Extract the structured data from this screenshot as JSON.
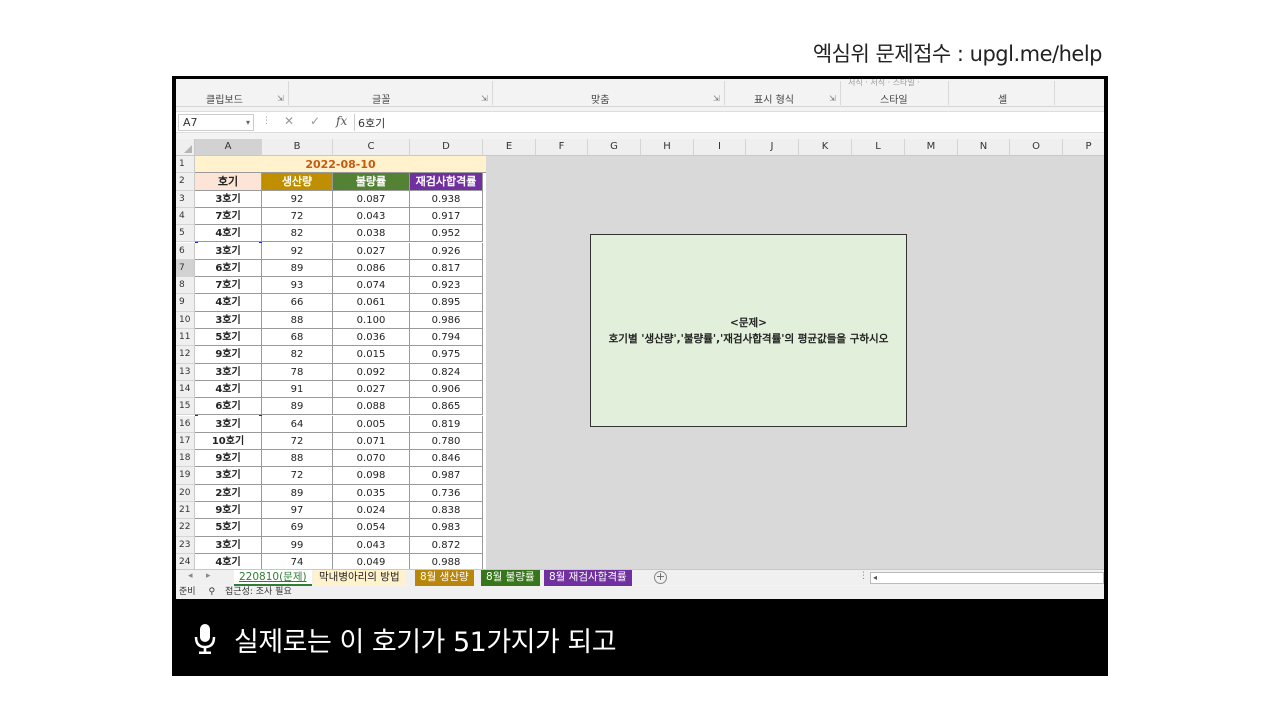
{
  "header_text": "엑심위 문제접수 : upgl.me/help",
  "ribbon": {
    "groups": [
      "클립보드",
      "글꼴",
      "맞춤",
      "표시 형식",
      "스타일",
      "셀"
    ],
    "faint_text": "서식 · 서식 · 스타일 ·"
  },
  "formula_bar": {
    "name_box": "A7",
    "cancel_icon": "✕",
    "enter_icon": "✓",
    "fx_label": "fx",
    "formula_value": "6호기"
  },
  "grid": {
    "columns": [
      "A",
      "B",
      "C",
      "D",
      "E",
      "F",
      "G",
      "H",
      "I",
      "J",
      "K",
      "L",
      "M",
      "N",
      "O",
      "P"
    ],
    "row_numbers": [
      "1",
      "2",
      "3",
      "4",
      "5",
      "6",
      "7",
      "8",
      "9",
      "10",
      "11",
      "12",
      "13",
      "14",
      "15",
      "16",
      "17",
      "18",
      "19",
      "20",
      "21",
      "22",
      "23",
      "24"
    ],
    "date_header": "2022-08-10",
    "headers": [
      "호기",
      "생산량",
      "불량률",
      "재검사합격률"
    ],
    "rows": [
      [
        "3호기",
        "92",
        "0.087",
        "0.938"
      ],
      [
        "7호기",
        "72",
        "0.043",
        "0.917"
      ],
      [
        "4호기",
        "82",
        "0.038",
        "0.952"
      ],
      [
        "3호기",
        "92",
        "0.027",
        "0.926"
      ],
      [
        "6호기",
        "89",
        "0.086",
        "0.817"
      ],
      [
        "7호기",
        "93",
        "0.074",
        "0.923"
      ],
      [
        "4호기",
        "66",
        "0.061",
        "0.895"
      ],
      [
        "3호기",
        "88",
        "0.100",
        "0.986"
      ],
      [
        "5호기",
        "68",
        "0.036",
        "0.794"
      ],
      [
        "9호기",
        "82",
        "0.015",
        "0.975"
      ],
      [
        "3호기",
        "78",
        "0.092",
        "0.824"
      ],
      [
        "4호기",
        "91",
        "0.027",
        "0.906"
      ],
      [
        "6호기",
        "89",
        "0.088",
        "0.865"
      ],
      [
        "3호기",
        "64",
        "0.005",
        "0.819"
      ],
      [
        "10호기",
        "72",
        "0.071",
        "0.780"
      ],
      [
        "9호기",
        "88",
        "0.070",
        "0.846"
      ],
      [
        "3호기",
        "72",
        "0.098",
        "0.987"
      ],
      [
        "2호기",
        "89",
        "0.035",
        "0.736"
      ],
      [
        "9호기",
        "97",
        "0.024",
        "0.838"
      ],
      [
        "5호기",
        "69",
        "0.054",
        "0.983"
      ],
      [
        "3호기",
        "99",
        "0.043",
        "0.872"
      ],
      [
        "4호기",
        "74",
        "0.049",
        "0.988"
      ]
    ]
  },
  "problem": {
    "title": "<문제>",
    "body": "호기별 '생산량','불량률','재검사합격률'의 평균값들을 구하시오"
  },
  "sheet_tabs": [
    {
      "label": "220810(문제)",
      "bg": "#ffffff",
      "color": "#2e7d32"
    },
    {
      "label": "막내병아리의 방법",
      "bg": "#fff2cc",
      "color": "#222222"
    },
    {
      "label": "8월 생산량",
      "bg": "#b8860b",
      "color": "#ffffff"
    },
    {
      "label": "8월 불량률",
      "bg": "#38761d",
      "color": "#ffffff"
    },
    {
      "label": "8월 재검사합격률",
      "bg": "#7030a0",
      "color": "#ffffff"
    }
  ],
  "status_bar": {
    "ready": "준비",
    "accessibility": "접근성: 조사 필요"
  },
  "caption": {
    "text": "실제로는 이 호기가 51가지가 되고"
  },
  "colors": {
    "header_a": "#fce4d6",
    "header_b": "#bf8f00",
    "header_c": "#548235",
    "header_d": "#7030a0",
    "selection_border": "#1423e8",
    "problem_bg": "#e2efda"
  }
}
